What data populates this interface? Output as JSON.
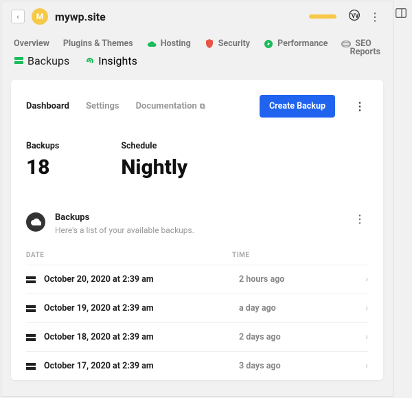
{
  "header": {
    "avatar_letter": "M",
    "site_name": "mywp.site"
  },
  "nav": {
    "items": [
      {
        "label": "Overview",
        "icon": null
      },
      {
        "label": "Plugins & Themes",
        "icon": null
      },
      {
        "label": "Hosting",
        "icon": "cloud",
        "color": "#1abc5b"
      },
      {
        "label": "Security",
        "icon": "shield",
        "color": "#e74c3c"
      },
      {
        "label": "Performance",
        "icon": "bolt",
        "color": "#1abc5b"
      },
      {
        "label": "SEO",
        "icon": "seo",
        "color": "#999"
      }
    ],
    "items2": [
      {
        "label": "Backups",
        "icon": "backups",
        "color": "#1abc5b",
        "active": true
      },
      {
        "label": "Insights",
        "icon": "insights",
        "color": "#1abc5b"
      }
    ],
    "reports": "Reports"
  },
  "tabs": {
    "dashboard": "Dashboard",
    "settings": "Settings",
    "documentation": "Documentation",
    "create": "Create Backup"
  },
  "stats": {
    "backups_label": "Backups",
    "backups_value": "18",
    "schedule_label": "Schedule",
    "schedule_value": "Nightly"
  },
  "list": {
    "title": "Backups",
    "subtitle": "Here's a list of your available backups.",
    "col_date": "DATE",
    "col_time": "TIME",
    "rows": [
      {
        "date": "October 20, 2020 at 2:39 am",
        "time": "2 hours ago"
      },
      {
        "date": "October 19, 2020 at 2:39 am",
        "time": "a day ago"
      },
      {
        "date": "October 18, 2020 at 2:39 am",
        "time": "2 days ago"
      },
      {
        "date": "October 17, 2020 at 2:39 am",
        "time": "3 days ago"
      }
    ]
  }
}
